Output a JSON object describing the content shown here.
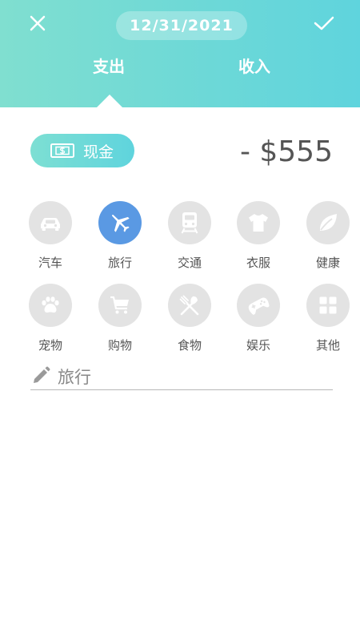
{
  "header": {
    "close_icon": "close-icon",
    "confirm_icon": "check-icon",
    "date": "12/31/2021",
    "tabs": [
      {
        "label": "支出",
        "active": true
      },
      {
        "label": "收入",
        "active": false
      }
    ],
    "gradient_colors": [
      "#80dfd0",
      "#5fd4dd"
    ]
  },
  "account": {
    "icon": "cash-icon",
    "label": "现金"
  },
  "amount": "- $555",
  "categories": [
    {
      "label": "汽车",
      "icon": "car-icon",
      "selected": false
    },
    {
      "label": "旅行",
      "icon": "airplane-icon",
      "selected": true
    },
    {
      "label": "交通",
      "icon": "train-icon",
      "selected": false
    },
    {
      "label": "衣服",
      "icon": "shirt-icon",
      "selected": false
    },
    {
      "label": "健康",
      "icon": "leaf-icon",
      "selected": false
    },
    {
      "label": "宠物",
      "icon": "paw-icon",
      "selected": false
    },
    {
      "label": "购物",
      "icon": "cart-icon",
      "selected": false
    },
    {
      "label": "食物",
      "icon": "utensils-icon",
      "selected": false
    },
    {
      "label": "娱乐",
      "icon": "gamepad-icon",
      "selected": false
    },
    {
      "label": "其他",
      "icon": "grid-icon",
      "selected": false
    }
  ],
  "note": {
    "icon": "pencil-icon",
    "value": "旅行"
  },
  "colors": {
    "selected_category": "#5a99e3",
    "unselected_category": "#e3e3e3",
    "amount_text": "#555555"
  }
}
